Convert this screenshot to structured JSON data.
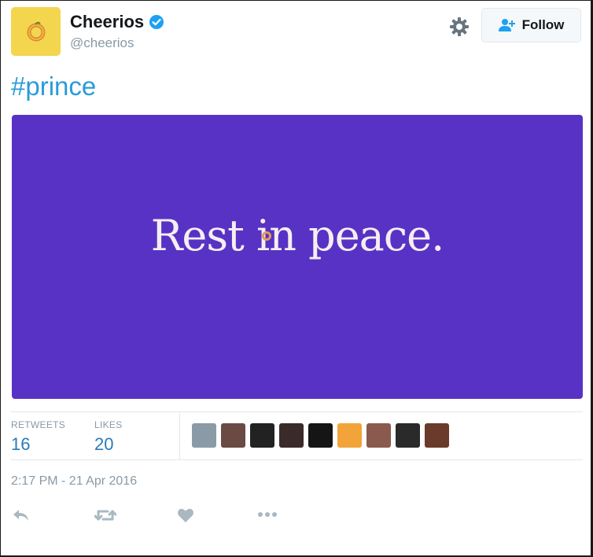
{
  "tweet": {
    "author": {
      "name": "Cheerios",
      "handle": "@cheerios",
      "verified": true,
      "avatar_color": "#f3d64e"
    },
    "follow_label": "Follow",
    "hashtag": "#prince",
    "media": {
      "text": "Rest in peace.",
      "background": "#5832c4"
    },
    "stats": {
      "retweets_label": "RETWEETS",
      "retweets": "16",
      "likes_label": "LIKES",
      "likes": "20"
    },
    "likers": [
      {
        "name": "liker-avatar",
        "color": "#8a9aa6"
      },
      {
        "name": "liker-avatar",
        "color": "#6b4a44"
      },
      {
        "name": "liker-avatar",
        "color": "#222222"
      },
      {
        "name": "liker-avatar",
        "color": "#3a2a2a"
      },
      {
        "name": "liker-avatar",
        "color": "#151515"
      },
      {
        "name": "liker-avatar",
        "color": "#f2a43a"
      },
      {
        "name": "liker-avatar",
        "color": "#8a5a4e"
      },
      {
        "name": "liker-avatar",
        "color": "#2a2a2a"
      },
      {
        "name": "liker-avatar",
        "color": "#6a3a2a"
      }
    ],
    "timestamp": "2:17 PM - 21 Apr 2016",
    "actions": [
      "reply-icon",
      "retweet-icon",
      "like-icon",
      "more-icon"
    ],
    "icon_color": "#aab8c2",
    "accent": "#2b9bd8"
  }
}
